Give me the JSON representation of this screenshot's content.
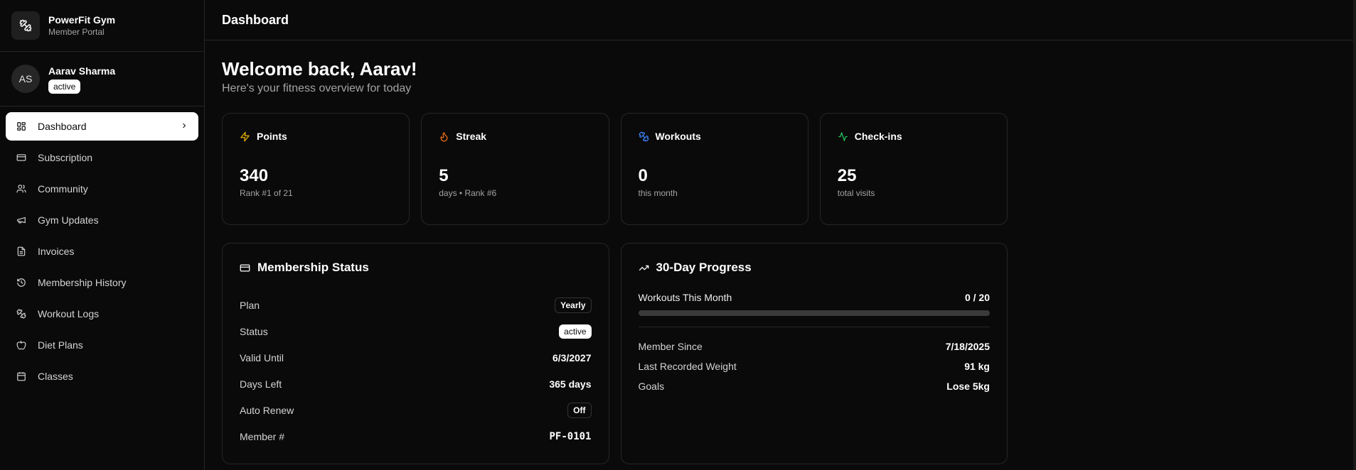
{
  "brand": {
    "name": "PowerFit Gym",
    "subtitle": "Member Portal"
  },
  "user": {
    "initials": "AS",
    "name": "Aarav Sharma",
    "status": "active"
  },
  "nav": [
    {
      "label": "Dashboard",
      "icon": "grid-icon",
      "active": true
    },
    {
      "label": "Subscription",
      "icon": "credit-card-icon"
    },
    {
      "label": "Community",
      "icon": "users-icon"
    },
    {
      "label": "Gym Updates",
      "icon": "megaphone-icon"
    },
    {
      "label": "Invoices",
      "icon": "file-icon"
    },
    {
      "label": "Membership History",
      "icon": "history-icon"
    },
    {
      "label": "Workout Logs",
      "icon": "dumbbell-icon"
    },
    {
      "label": "Diet Plans",
      "icon": "apple-icon"
    },
    {
      "label": "Classes",
      "icon": "calendar-icon"
    }
  ],
  "header": {
    "title": "Dashboard"
  },
  "welcome": {
    "title": "Welcome back, Aarav!",
    "subtitle": "Here's your fitness overview for today"
  },
  "stats": [
    {
      "label": "Points",
      "value": "340",
      "sub": "Rank #1 of 21",
      "icon": "zap-icon",
      "color": "#eab308"
    },
    {
      "label": "Streak",
      "value": "5",
      "sub": "days • Rank #6",
      "icon": "flame-icon",
      "color": "#f97316"
    },
    {
      "label": "Workouts",
      "value": "0",
      "sub": "this month",
      "icon": "dumbbell-icon",
      "color": "#3b82f6"
    },
    {
      "label": "Check-ins",
      "value": "25",
      "sub": "total visits",
      "icon": "activity-icon",
      "color": "#22c55e"
    }
  ],
  "membership": {
    "title": "Membership Status",
    "plan_label": "Plan",
    "plan_value": "Yearly",
    "status_label": "Status",
    "status_value": "active",
    "valid_label": "Valid Until",
    "valid_value": "6/3/2027",
    "days_label": "Days Left",
    "days_value": "365 days",
    "renew_label": "Auto Renew",
    "renew_value": "Off",
    "member_label": "Member #",
    "member_value": "PF-0101"
  },
  "progress": {
    "title": "30-Day Progress",
    "workouts_label": "Workouts This Month",
    "workouts_value": "0 / 20",
    "workouts_fraction": 0,
    "since_label": "Member Since",
    "since_value": "7/18/2025",
    "weight_label": "Last Recorded Weight",
    "weight_value": "91 kg",
    "goals_label": "Goals",
    "goals_value": "Lose 5kg"
  }
}
